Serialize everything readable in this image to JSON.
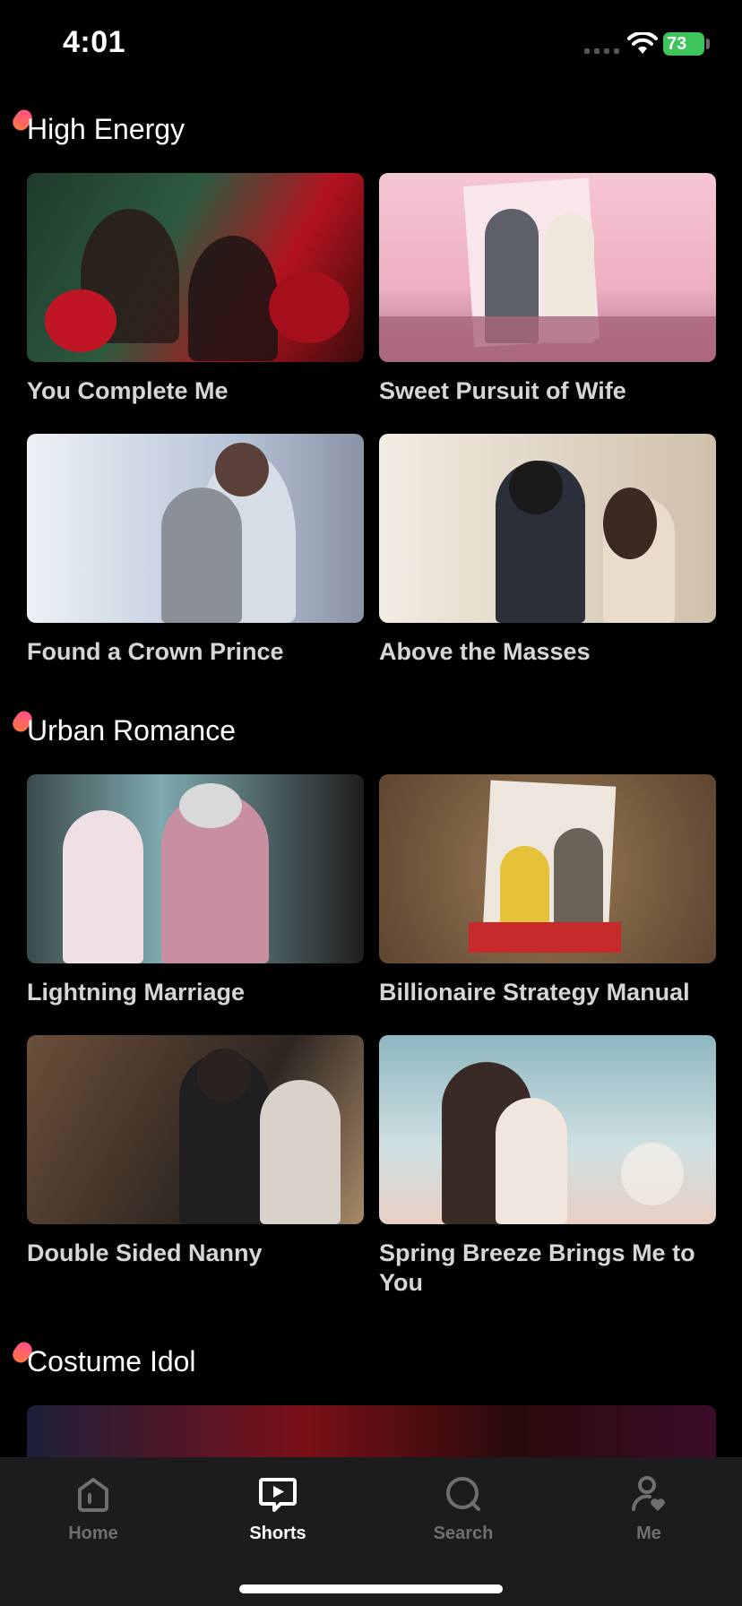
{
  "status_bar": {
    "time": "4:01",
    "battery": "73"
  },
  "sections": [
    {
      "title": "High Energy",
      "items": [
        {
          "title": "You Complete Me",
          "colors": [
            "#1f3a2b",
            "#b3121f",
            "#3a0c0c"
          ]
        },
        {
          "title": "Sweet Pursuit of Wife",
          "colors": [
            "#f6c6d3",
            "#e8a2b5",
            "#b0728a"
          ]
        },
        {
          "title": "Found a Crown Prince",
          "colors": [
            "#dfe6ef",
            "#b8c5d8",
            "#5a4a4a"
          ]
        },
        {
          "title": "Above the Masses",
          "colors": [
            "#efe7dc",
            "#cfc0aa",
            "#2b2f3a"
          ]
        }
      ]
    },
    {
      "title": "Urban Romance",
      "items": [
        {
          "title": "Lightning Marriage",
          "colors": [
            "#3a4a4a",
            "#c78fa0",
            "#141414"
          ]
        },
        {
          "title": "Billionaire Strategy Manual",
          "colors": [
            "#8a6a48",
            "#5e4530",
            "#e6c23a"
          ]
        },
        {
          "title": "Double Sided Nanny",
          "colors": [
            "#6b4f3a",
            "#2e2620",
            "#a88a6a"
          ]
        },
        {
          "title": "Spring Breeze Brings Me to You",
          "colors": [
            "#8fb7c0",
            "#e9cfc3",
            "#3a2a26"
          ]
        }
      ]
    },
    {
      "title": "Costume Idol",
      "items": []
    }
  ],
  "tabs": [
    {
      "label": "Home",
      "icon": "home-icon",
      "active": false
    },
    {
      "label": "Shorts",
      "icon": "play-icon",
      "active": true
    },
    {
      "label": "Search",
      "icon": "search-icon",
      "active": false
    },
    {
      "label": "Me",
      "icon": "profile-icon",
      "active": false
    }
  ],
  "colors": {
    "background": "#000000",
    "tab_bar": "#1c1c1e",
    "inactive_tab": "#6e6e73",
    "accent_pink": "#ff4d8d",
    "battery_green": "#3dc45a"
  }
}
